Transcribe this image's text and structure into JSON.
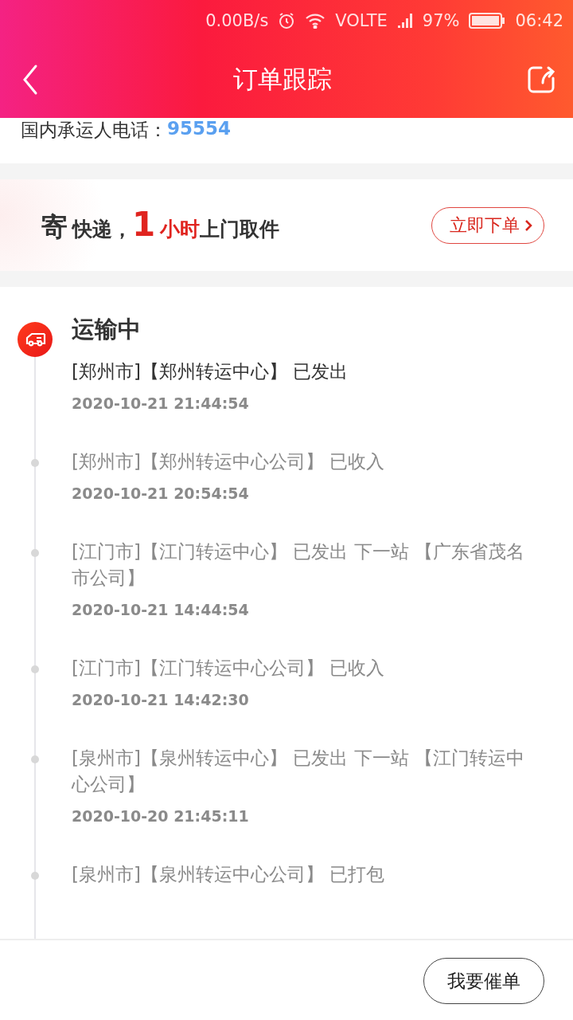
{
  "status_bar": {
    "speed": "0.00B/s",
    "network": "VOLTE",
    "battery": "97%",
    "time": "06:42"
  },
  "header": {
    "title": "订单跟踪"
  },
  "carrier": {
    "label": "国内承运人电话：",
    "phone": "95554"
  },
  "banner": {
    "parts": [
      {
        "kind": "lead",
        "text": "寄"
      },
      {
        "kind": "plain",
        "text": "快递，"
      },
      {
        "kind": "number",
        "text": "1"
      },
      {
        "kind": "accent",
        "text": "小时"
      },
      {
        "kind": "plain",
        "text": "上门取件"
      }
    ],
    "button": "立即下单"
  },
  "tracking": {
    "status": "运输中",
    "events": [
      {
        "current": true,
        "text": "[郑州市]【郑州转运中心】 已发出",
        "time": "2020-10-21 21:44:54"
      },
      {
        "current": false,
        "text": "[郑州市]【郑州转运中心公司】 已收入",
        "time": "2020-10-21 20:54:54"
      },
      {
        "current": false,
        "text": "[江门市]【江门转运中心】 已发出 下一站 【广东省茂名市公司】",
        "time": "2020-10-21 14:44:54"
      },
      {
        "current": false,
        "text": "[江门市]【江门转运中心公司】 已收入",
        "time": "2020-10-21 14:42:30"
      },
      {
        "current": false,
        "text": "[泉州市]【泉州转运中心】 已发出 下一站 【江门转运中心公司】",
        "time": "2020-10-20 21:45:11"
      },
      {
        "current": false,
        "text": "[泉州市]【泉州转运中心公司】 已打包"
      }
    ]
  },
  "footer": {
    "button": "我要催单"
  }
}
